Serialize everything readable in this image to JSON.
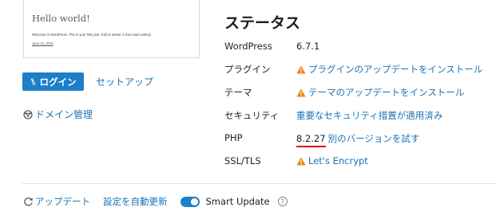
{
  "preview": {
    "site_title": "Hello world!",
    "post_text": "Welcome to WordPress. This is your first post. Edit or delete it, then start writing!",
    "date_link": "June 12, 2024"
  },
  "left_panel": {
    "login_label": "ログイン",
    "setup_label": "セットアップ",
    "domain_label": "ドメイン管理"
  },
  "status": {
    "heading": "ステータス",
    "rows": [
      {
        "label": "WordPress",
        "value": "6.7.1"
      },
      {
        "label": "プラグイン",
        "value": "プラグインのアップデートをインストール"
      },
      {
        "label": "テーマ",
        "value": "テーマのアップデートをインストール"
      },
      {
        "label": "セキュリティ",
        "value": "重要なセキュリティ措置が適用済み"
      },
      {
        "label": "PHP",
        "value": "8.2.27",
        "link": "別のバージョンを試す"
      },
      {
        "label": "SSL/TLS",
        "value": "Let's Encrypt"
      }
    ]
  },
  "bottom": {
    "update_label": "アップデート",
    "auto_update_label": "設定を自動更新",
    "smart_update_label": "Smart Update",
    "smart_update_on": true
  },
  "colors": {
    "accent": "#1c7fc7",
    "link": "#1a73b5",
    "warning": "#e8841a",
    "underline": "#e00000"
  }
}
